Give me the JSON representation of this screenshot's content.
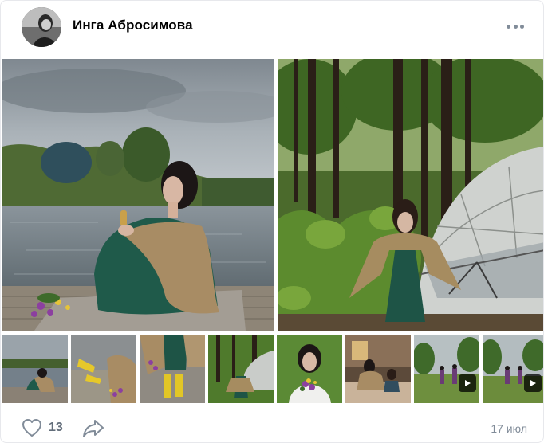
{
  "post": {
    "author": "Инга Абросимова",
    "date": "17 июл",
    "likes": "13"
  },
  "icons": {
    "more": "more-horizontal-icon",
    "like": "heart-icon",
    "share": "share-arrow-icon",
    "play": "play-icon"
  },
  "colors": {
    "icon_gray": "#818c99",
    "count_gray": "#626d7a"
  },
  "gallery": {
    "main_count": 2,
    "thumb_count": 8,
    "video_thumbs": [
      7,
      8
    ]
  }
}
